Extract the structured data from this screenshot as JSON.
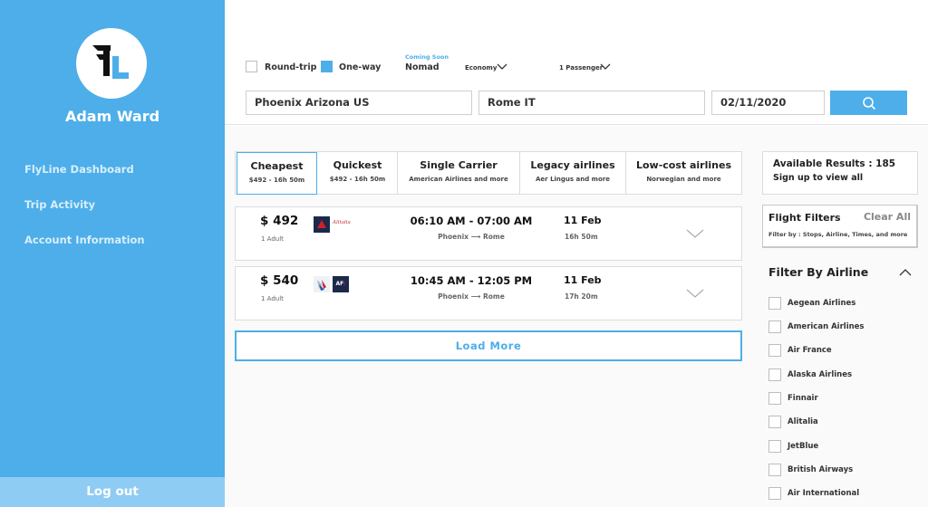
{
  "user": {
    "name": "Adam Ward"
  },
  "nav": {
    "items": [
      {
        "label": "FlyLine Dashboard"
      },
      {
        "label": "Trip Activity"
      },
      {
        "label": "Account Information"
      }
    ],
    "logout_label": "Log out"
  },
  "search": {
    "trip_types": [
      {
        "label": "Round-trip",
        "checked": false
      },
      {
        "label": "One-way",
        "checked": true
      }
    ],
    "nomad_badge": "Coming Soon",
    "nomad_label": "Nomad",
    "cabin": "Economy",
    "passengers": "1 Passenger",
    "origin": "Phoenix Arizona US",
    "destination": "Rome  IT",
    "date": "02/11/2020",
    "search_icon": "search-icon"
  },
  "sort_tabs": [
    {
      "title": "Cheapest",
      "sub": "$492 - 16h 50m",
      "selected": true
    },
    {
      "title": "Quickest",
      "sub": "$492 - 16h 50m",
      "selected": false
    },
    {
      "title": "Single Carrier",
      "sub": "American Airlines and more",
      "selected": false
    },
    {
      "title": "Legacy airlines",
      "sub": "Aer Lingus and more",
      "selected": false
    },
    {
      "title": "Low-cost airlines",
      "sub": "Norwegian and more",
      "selected": false
    }
  ],
  "results": [
    {
      "price": "$ 492",
      "pax": "1 Adult",
      "times": "06:10 AM - 07:00 AM",
      "from": "Phoenix",
      "to": "Rome",
      "date": "11 Feb",
      "duration": "16h 50m",
      "airline_logos": [
        "delta-logo",
        "alitalia-logo"
      ],
      "alitalia_text": "Alitalia"
    },
    {
      "price": "$ 540",
      "pax": "1 Adult",
      "times": "10:45 AM - 12:05 PM",
      "from": "Phoenix",
      "to": "Rome",
      "date": "11 Feb",
      "duration": "17h 20m",
      "airline_logos": [
        "american-airlines-logo",
        "air-france-logo"
      ],
      "af_text": "AF"
    }
  ],
  "load_more_label": "Load More",
  "available": {
    "text": "Available Results : 185",
    "signup": "Sign up to view all"
  },
  "flight_filters": {
    "title": "Flight Filters",
    "clear": "Clear All",
    "sub": "Filter by : Stops, Airline, Times, and more"
  },
  "filter_by_airline": {
    "title": "Filter By Airline",
    "airlines": [
      "Aegean Airlines",
      "American Airlines",
      "Air France",
      "Alaska Airlines",
      "Finnair",
      "Alitalia",
      "JetBlue",
      "British Airways",
      "Air International"
    ]
  },
  "colors": {
    "accent": "#4daeea",
    "logout_bg": "#8fccf3",
    "sidebar_text": "#d8eefb"
  }
}
